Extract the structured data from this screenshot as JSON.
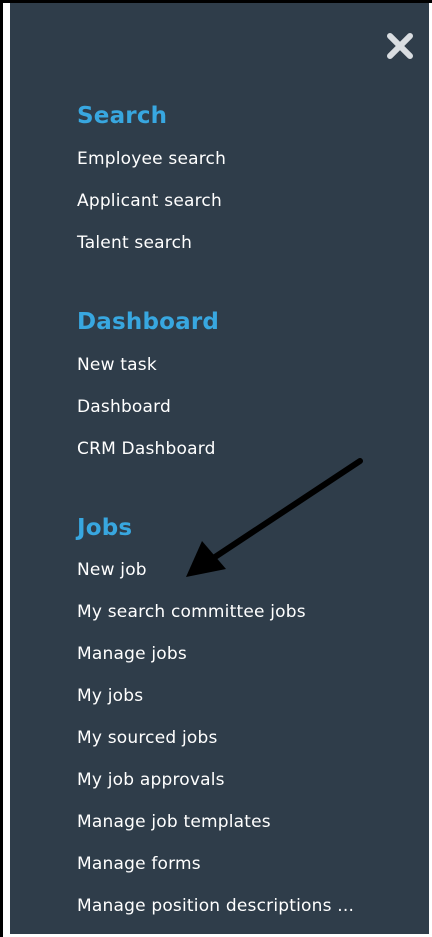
{
  "close_icon": "close-icon",
  "colors": {
    "panel_bg": "#2f3d4a",
    "section_title": "#38a7e0",
    "item_text": "#ffffff",
    "close_icon": "#d9dde1",
    "annotation_arrow": "#000000"
  },
  "sections": [
    {
      "title": "Search",
      "items": [
        "Employee search",
        "Applicant search",
        "Talent search"
      ]
    },
    {
      "title": "Dashboard",
      "items": [
        "New task",
        "Dashboard",
        "CRM Dashboard"
      ]
    },
    {
      "title": "Jobs",
      "items": [
        "New job",
        "My search committee jobs",
        "Manage jobs",
        "My jobs",
        "My sourced jobs",
        "My job approvals",
        "Manage job templates",
        "Manage forms",
        "Manage position descriptions ..."
      ]
    }
  ]
}
